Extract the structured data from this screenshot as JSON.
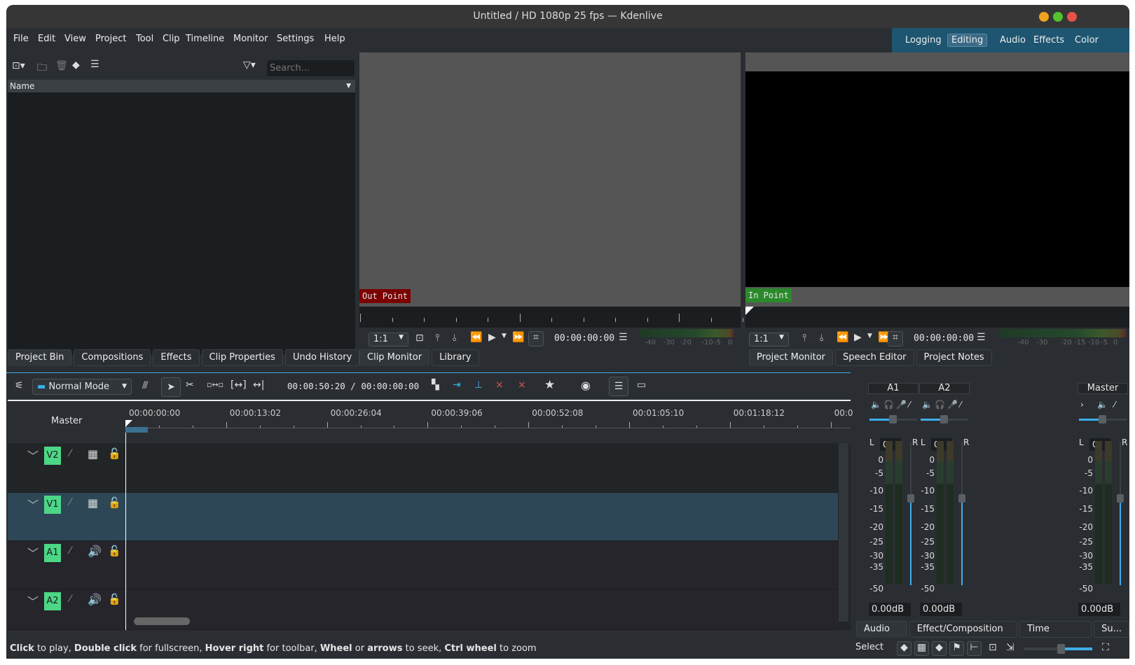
{
  "window": {
    "title": "Untitled / HD 1080p 25 fps — Kdenlive",
    "controls": [
      "minimize",
      "maximize",
      "close"
    ],
    "control_colors": [
      "#f0a31c",
      "#53c22e",
      "#e8504a"
    ]
  },
  "menu": [
    "File",
    "Edit",
    "View",
    "Project",
    "Tool",
    "Clip",
    "Timeline",
    "Monitor",
    "Settings",
    "Help"
  ],
  "workspaces": {
    "items": [
      "Logging",
      "Editing",
      "Audio",
      "Effects",
      "Color"
    ],
    "active": "Editing",
    "bg": "#1e5570"
  },
  "bin": {
    "search_placeholder": "Search...",
    "column_name": "Name",
    "toolbar_icons": [
      "add-clip-icon",
      "new-folder-icon",
      "delete-icon",
      "tag-icon",
      "menu-icon",
      "filter-icon"
    ]
  },
  "left_tabs": [
    "Project Bin",
    "Compositions",
    "Effects",
    "Clip Properties",
    "Undo History"
  ],
  "clip_monitor": {
    "marker": "Out Point",
    "marker_color": "#7a0000",
    "zoom": "1:1",
    "timecode": "00:00:00:00",
    "meter_scale": [
      "-40",
      "-30",
      "-20",
      "-10",
      "-5",
      "0"
    ],
    "tabs": [
      "Clip Monitor",
      "Library"
    ]
  },
  "project_monitor": {
    "marker": "In Point",
    "marker_color": "#2a8a2a",
    "zoom": "1:1",
    "timecode": "00:00:00:00",
    "meter_scale": [
      "-40",
      "-30",
      "-20",
      "-15",
      "-10",
      "-5",
      "0"
    ],
    "tabs": [
      "Project Monitor",
      "Speech Editor",
      "Project Notes"
    ]
  },
  "timeline": {
    "mode": "Normal Mode",
    "position": "00:00:50:20 / 00:00:00:00",
    "master_label": "Master",
    "ruler": [
      "00:00:00:00",
      "00:00:13:02",
      "00:00:26:04",
      "00:00:39:06",
      "00:00:52:08",
      "00:01:05:10",
      "00:01:18:12",
      "00:0"
    ],
    "tracks": [
      {
        "name": "V2",
        "type": "video",
        "selected": false
      },
      {
        "name": "V1",
        "type": "video",
        "selected": true
      },
      {
        "name": "A1",
        "type": "audio",
        "selected": false
      },
      {
        "name": "A2",
        "type": "audio",
        "selected": false
      }
    ]
  },
  "mixer": {
    "channels": [
      {
        "name": "A1",
        "balance": "0",
        "gain": "0.00dB",
        "volume_fraction": 0.5
      },
      {
        "name": "A2",
        "balance": "0",
        "gain": "0.00dB",
        "volume_fraction": 0.5
      },
      {
        "name": "Master",
        "balance": "0",
        "gain": "0.00dB",
        "volume_fraction": 0.5
      }
    ],
    "scale": [
      "0",
      "-5",
      "-10",
      "-15",
      "-20",
      "-25",
      "-30",
      "-35",
      "-50"
    ],
    "L": "L",
    "R": "R"
  },
  "right_tabs": [
    "Audio ...",
    "Effect/Composition ...",
    "Time Rema...",
    "Su..."
  ],
  "statusbar": {
    "hint": [
      {
        "b": true,
        "t": "Click"
      },
      {
        "b": false,
        "t": " to play, "
      },
      {
        "b": true,
        "t": "Double click"
      },
      {
        "b": false,
        "t": " for fullscreen, "
      },
      {
        "b": true,
        "t": "Hover right"
      },
      {
        "b": false,
        "t": " for toolbar, "
      },
      {
        "b": true,
        "t": "Wheel"
      },
      {
        "b": false,
        "t": " or "
      },
      {
        "b": true,
        "t": "arrows"
      },
      {
        "b": false,
        "t": " to seek, "
      },
      {
        "b": true,
        "t": "Ctrl wheel"
      },
      {
        "b": false,
        "t": " to zoom"
      }
    ],
    "tool": "Select",
    "zoom_fraction": 0.55
  }
}
